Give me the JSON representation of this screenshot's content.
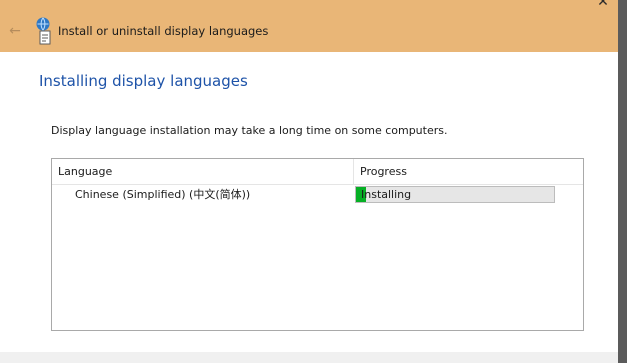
{
  "window": {
    "title": "Install or uninstall display languages",
    "titlebar_color": "#e9b677"
  },
  "page": {
    "heading": "Installing display languages",
    "info": "Display language installation may take a long time on some computers."
  },
  "listview": {
    "columns": [
      "Language",
      "Progress"
    ],
    "rows": [
      {
        "language": "Chinese (Simplified) (中文(简体))",
        "status": "Installing",
        "progress": 0.05
      }
    ]
  },
  "colors": {
    "heading": "#1e53a8",
    "progress_fill": "#06b025"
  },
  "icons": {
    "back": "back-arrow-icon",
    "app": "language-globe-icon",
    "close": "close-icon"
  }
}
